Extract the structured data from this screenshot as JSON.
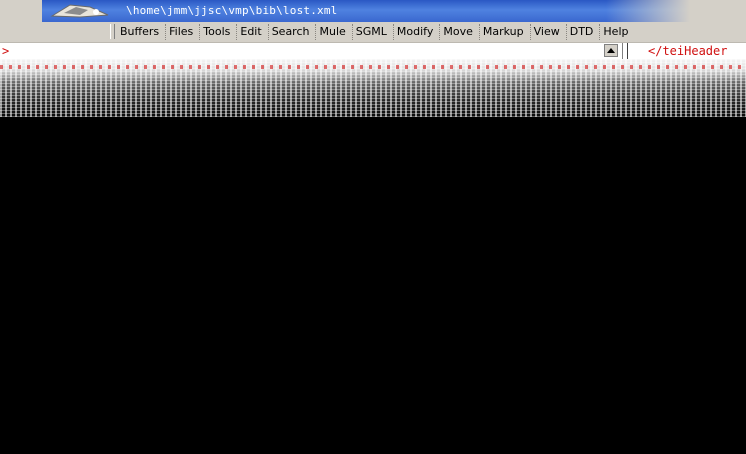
{
  "window": {
    "title": "\\home\\jmm\\jjsc\\vmp\\bib\\lost.xml"
  },
  "menu": {
    "items": [
      {
        "label": "Buffers"
      },
      {
        "label": "Files"
      },
      {
        "label": "Tools"
      },
      {
        "label": "Edit"
      },
      {
        "label": "Search"
      },
      {
        "label": "Mule"
      },
      {
        "label": "SGML"
      },
      {
        "label": "Modify"
      },
      {
        "label": "Move"
      },
      {
        "label": "Markup"
      },
      {
        "label": "View"
      },
      {
        "label": "DTD"
      },
      {
        "label": "Help"
      }
    ]
  },
  "editor": {
    "left_text": ">",
    "right_text": "</teiHeader"
  },
  "colors": {
    "title_bar": "#3a67cf",
    "menu_bg": "#d4d0c8",
    "markup_red": "#d01010",
    "background": "#000000"
  },
  "icons": {
    "app_icon": "emacs-icon",
    "scroll_up": "scroll-up-arrow-icon"
  }
}
